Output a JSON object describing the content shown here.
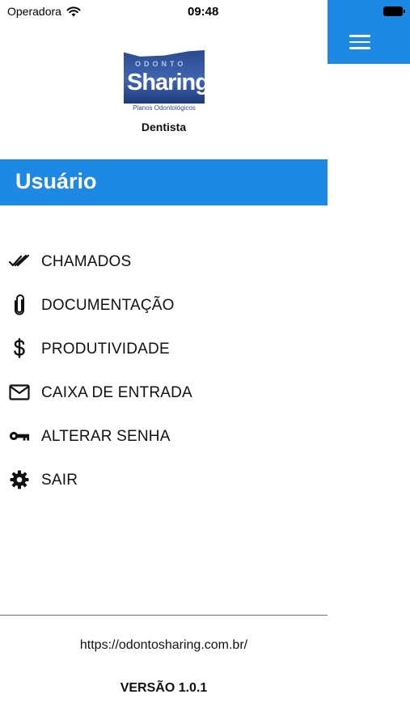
{
  "status_bar": {
    "carrier": "Operadora",
    "time": "09:48",
    "wifi_icon": "wifi-icon",
    "battery_icon": "battery-icon"
  },
  "header": {
    "menu_icon": "hamburger-menu-icon",
    "color": "#1e88e5"
  },
  "logo": {
    "top_text": "ODONTO",
    "brand": "Sharing",
    "subtitle": "Planos Odontológicos"
  },
  "role": "Dentista",
  "section_title": "Usuário",
  "menu": [
    {
      "label": "CHAMADOS",
      "icon": "double-check-icon"
    },
    {
      "label": "DOCUMENTAÇÃO",
      "icon": "paperclip-icon"
    },
    {
      "label": "PRODUTIVIDADE",
      "icon": "dollar-icon"
    },
    {
      "label": "CAIXA DE ENTRADA",
      "icon": "mail-icon"
    },
    {
      "label": "ALTERAR SENHA",
      "icon": "key-icon"
    },
    {
      "label": "SAIR",
      "icon": "gear-icon"
    }
  ],
  "footer": {
    "url": "https://odontosharing.com.br/",
    "version": "VERSÃO 1.0.1"
  },
  "colors": {
    "accent": "#1e88e5",
    "text": "#111111",
    "divider": "#6f6f6f"
  }
}
